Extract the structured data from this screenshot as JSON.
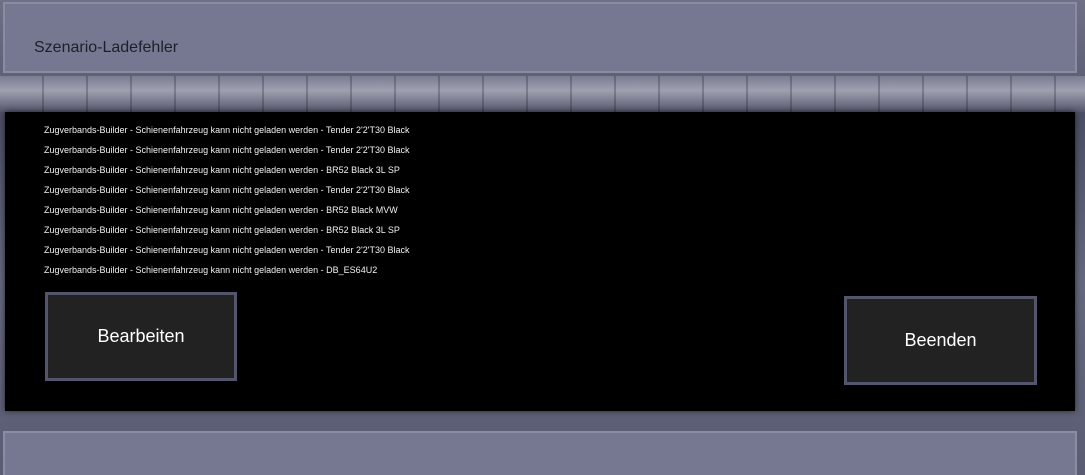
{
  "dialog": {
    "title": "Szenario-Ladefehler",
    "messages": [
      "Zugverbands-Builder - Schienenfahrzeug kann nicht geladen werden - Tender 2'2'T30 Black",
      "Zugverbands-Builder - Schienenfahrzeug kann nicht geladen werden - Tender 2'2'T30 Black",
      "Zugverbands-Builder - Schienenfahrzeug kann nicht geladen werden - BR52 Black 3L SP",
      "Zugverbands-Builder - Schienenfahrzeug kann nicht geladen werden - Tender 2'2'T30 Black",
      "Zugverbands-Builder - Schienenfahrzeug kann nicht geladen werden - BR52 Black MVW",
      "Zugverbands-Builder - Schienenfahrzeug kann nicht geladen werden - BR52 Black 3L SP",
      "Zugverbands-Builder - Schienenfahrzeug kann nicht geladen werden - Tender 2'2'T30 Black",
      "Zugverbands-Builder - Schienenfahrzeug kann nicht geladen werden - DB_ES64U2"
    ],
    "buttons": {
      "edit_label": "Bearbeiten",
      "quit_label": "Beenden"
    }
  },
  "colors": {
    "panel": "#000000",
    "button": "#222222",
    "button_border": "#53556b",
    "bar": "#767891",
    "text": "#ffffff"
  }
}
